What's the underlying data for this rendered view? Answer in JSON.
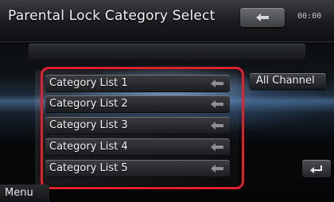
{
  "header": {
    "title": "Parental Lock Category Select",
    "time": "00:00"
  },
  "categories": [
    {
      "label": "Category List 1"
    },
    {
      "label": "Category List 2"
    },
    {
      "label": "Category List 3"
    },
    {
      "label": "Category List 4"
    },
    {
      "label": "Category List 5"
    }
  ],
  "right_panel": {
    "all_channel_label": "All Channel"
  },
  "footer": {
    "menu_label": "Menu"
  },
  "colors": {
    "highlight": "#e0202a",
    "text": "#f5f5f5"
  },
  "icons": {
    "header_back": "return-arrow-icon",
    "category_select": "select-arrow-icon",
    "back": "back-arrow-icon"
  }
}
